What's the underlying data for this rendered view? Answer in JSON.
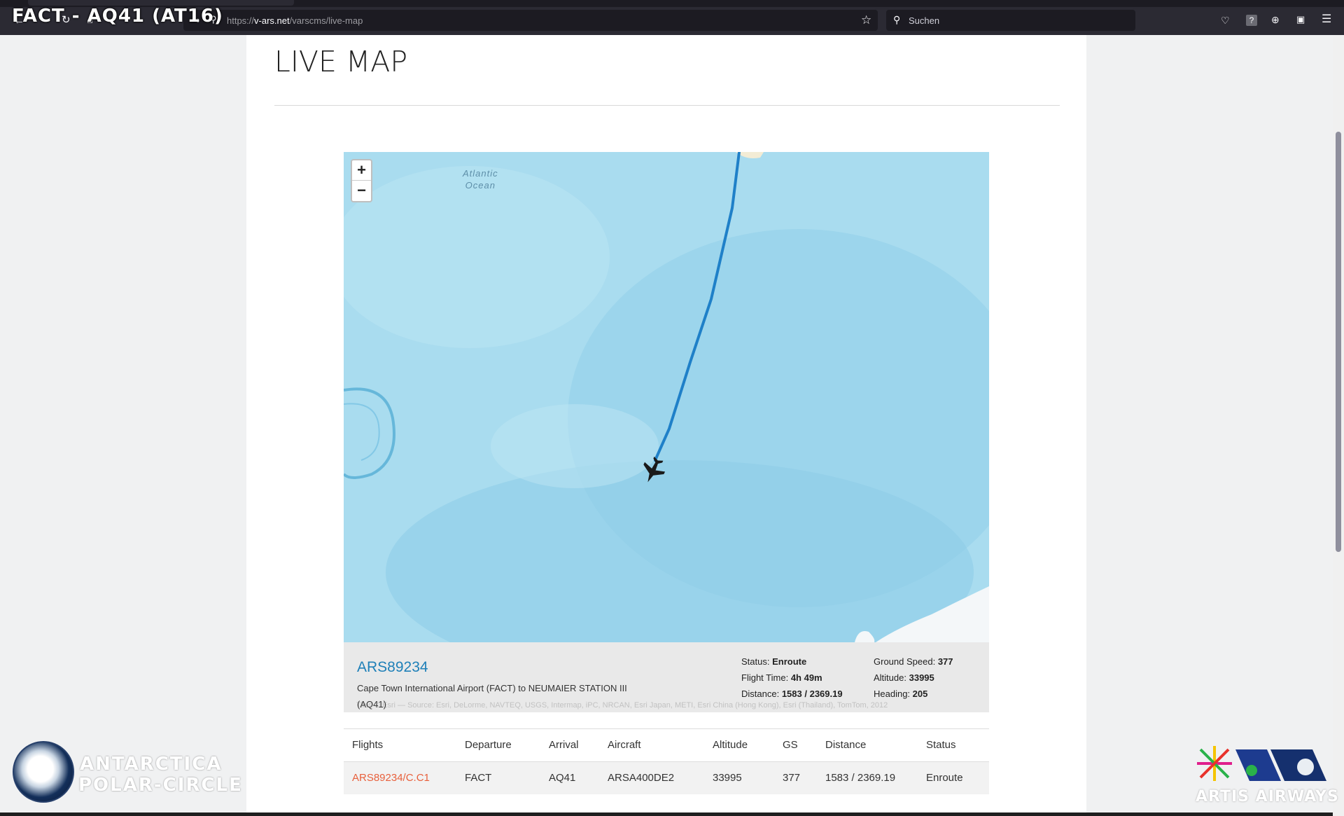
{
  "overlay": {
    "title": "FACT - AQ41 (AT16)"
  },
  "browser": {
    "url_prefix": "https://",
    "url_domain": "v-ars.net",
    "url_path": "/varscms/live-map",
    "search_placeholder": "Suchen"
  },
  "page": {
    "title": "LIVE MAP"
  },
  "map": {
    "zoom_in_label": "+",
    "zoom_out_label": "−",
    "ocean_label_line1": "Atlantic",
    "ocean_label_line2": "Ocean",
    "route_color": "#1f80c8",
    "water_color": "#a9dcef"
  },
  "flight_info": {
    "code": "ARS89234",
    "route": "Cape Town International Airport (FACT) to NEUMAIER STATION III (AQ41)",
    "status_label": "Status:",
    "status_value": "Enroute",
    "flight_time_label": "Flight Time:",
    "flight_time_value": "4h 49m",
    "distance_label": "Distance:",
    "distance_value": "1583 / 2369.19",
    "ground_speed_label": "Ground Speed:",
    "ground_speed_value": "377",
    "altitude_label": "Altitude:",
    "altitude_value": "33995",
    "heading_label": "Heading:",
    "heading_value": "205",
    "attribution": "Tiles © Esri — Source: Esri, DeLorme, NAVTEQ, USGS, Intermap, iPC, NRCAN, Esri Japan, METI, Esri China (Hong Kong), Esri (Thailand), TomTom, 2012"
  },
  "table": {
    "headers": [
      "Flights",
      "Departure",
      "Arrival",
      "Aircraft",
      "Altitude",
      "GS",
      "Distance",
      "Status"
    ],
    "rows": [
      [
        "ARS89234/C.C1",
        "FACT",
        "AQ41",
        "ARSA400DE2",
        "33995",
        "377",
        "1583 / 2369.19",
        "Enroute"
      ]
    ]
  },
  "logos": {
    "left_line1": "ANTARCTICA",
    "left_line2": "POLAR-CIRCLE",
    "right_text": "ARTIS AIRWAYS"
  }
}
